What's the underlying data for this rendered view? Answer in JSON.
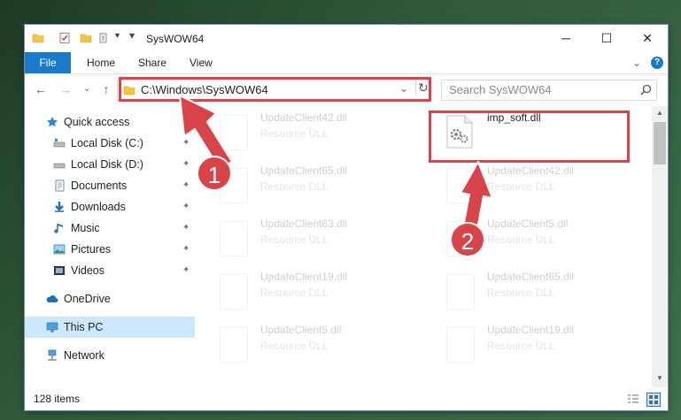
{
  "window": {
    "title": "SysWOW64",
    "minimize_glyph": "─",
    "maximize_glyph": "☐",
    "close_glyph": "✕"
  },
  "ribbon": {
    "tabs": [
      "File",
      "Home",
      "Share",
      "View"
    ],
    "collapse_glyph": "⌄",
    "help_glyph": "?"
  },
  "nav": {
    "back_glyph": "←",
    "forward_glyph": "→",
    "recent_glyph": "⌄",
    "up_glyph": "↑"
  },
  "address": {
    "path": "C:\\Windows\\SysWOW64",
    "dropdown_glyph": "⌄",
    "refresh_glyph": "↻"
  },
  "search": {
    "placeholder": "Search SysWOW64",
    "icon": "search-icon"
  },
  "sidebar": {
    "items": [
      {
        "label": "Quick access",
        "icon": "star-icon",
        "pinned": false,
        "top": true
      },
      {
        "label": "Local Disk (C:)",
        "icon": "drive-icon",
        "pinned": true
      },
      {
        "label": "Local Disk (D:)",
        "icon": "drive-icon",
        "pinned": true
      },
      {
        "label": "Documents",
        "icon": "documents-icon",
        "pinned": true
      },
      {
        "label": "Downloads",
        "icon": "download-icon",
        "pinned": true
      },
      {
        "label": "Music",
        "icon": "music-icon",
        "pinned": true
      },
      {
        "label": "Pictures",
        "icon": "pictures-icon",
        "pinned": true
      },
      {
        "label": "Videos",
        "icon": "videos-icon",
        "pinned": true
      },
      {
        "label": "OneDrive",
        "icon": "cloud-icon",
        "pinned": false,
        "top": true
      },
      {
        "label": "This PC",
        "icon": "computer-icon",
        "pinned": false,
        "top": true,
        "selected": true
      },
      {
        "label": "Network",
        "icon": "network-icon",
        "pinned": false,
        "top": true
      }
    ],
    "pin_glyph": "📌"
  },
  "files": [
    {
      "name": "UpdateClient42.dll",
      "type": "Resource DLL",
      "faded": true
    },
    {
      "name": "imp_soft.dll",
      "type": "",
      "faded": false
    },
    {
      "name": "UpdateClient65.dll",
      "type": "Resource DLL",
      "faded": true
    },
    {
      "name": "UpdateClient42.dll",
      "type": "Resource DLL",
      "faded": true
    },
    {
      "name": "UpdateClient63.dll",
      "type": "Resource DLL",
      "faded": true
    },
    {
      "name": "UpdateClient5.dll",
      "type": "Resource DLL",
      "faded": true
    },
    {
      "name": "UpdateClient19.dll",
      "type": "Resource DLL",
      "faded": true
    },
    {
      "name": "UpdateClient65.dll",
      "type": "Resource DLL",
      "faded": true
    },
    {
      "name": "UpdateClient5.dll",
      "type": "Resource DLL",
      "faded": true
    },
    {
      "name": "UpdateClient19.dll",
      "type": "Resource DLL",
      "faded": true
    }
  ],
  "status": {
    "item_count": "128 items"
  },
  "annotations": {
    "step1": "1",
    "step2": "2",
    "color": "#d9434a"
  },
  "colors": {
    "accent": "#1979ca",
    "selection": "#cce8ff"
  }
}
